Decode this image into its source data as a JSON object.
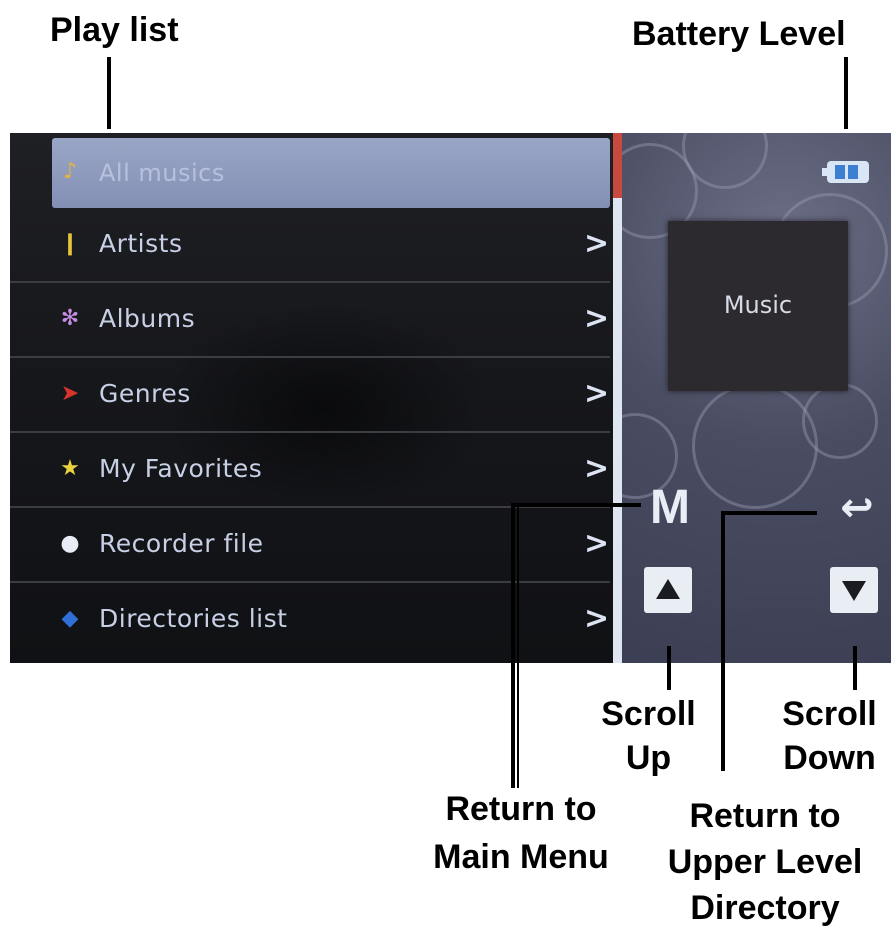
{
  "callouts": {
    "play_list": "Play list",
    "battery_level": "Battery Level",
    "scroll_up_1": "Scroll",
    "scroll_up_2": "Up",
    "scroll_down_1": "Scroll",
    "scroll_down_2": "Down",
    "return_main_1": "Return to",
    "return_main_2": "Main Menu",
    "return_upper_1": "Return to",
    "return_upper_2": "Upper Level",
    "return_upper_3": "Directory"
  },
  "menu": {
    "items": [
      {
        "label": "All musics",
        "icon": "music-note-icon",
        "selected": true
      },
      {
        "label": "Artists",
        "icon": "artist-icon",
        "chevron": ">"
      },
      {
        "label": "Albums",
        "icon": "album-icon",
        "chevron": ">"
      },
      {
        "label": "Genres",
        "icon": "genre-icon",
        "chevron": ">"
      },
      {
        "label": "My Favorites",
        "icon": "star-icon",
        "chevron": ">"
      },
      {
        "label": "Recorder file",
        "icon": "microphone-icon",
        "chevron": ">"
      },
      {
        "label": "Directories list",
        "icon": "folder-icon",
        "chevron": ">"
      }
    ]
  },
  "side_panel": {
    "music_label": "Music",
    "main_menu_key": "M",
    "back_symbol": "↩"
  },
  "colors": {
    "selected_row": "#8f9bbd",
    "scroll_thumb": "#c8493d",
    "battery_fill": "#3d7fd0"
  }
}
